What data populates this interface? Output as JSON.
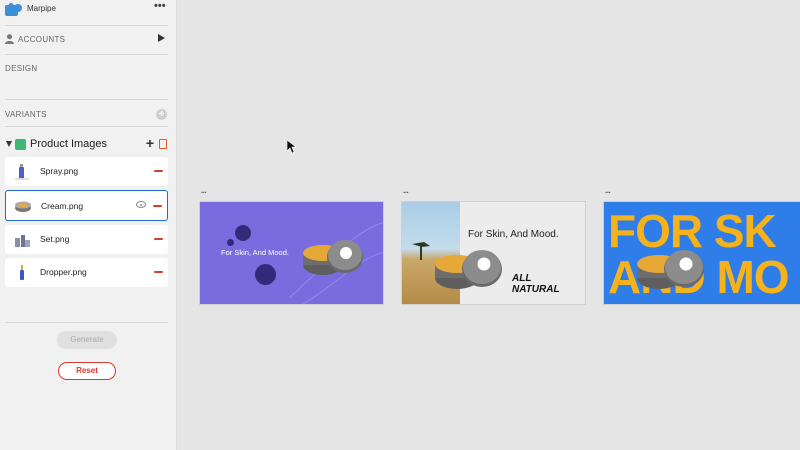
{
  "app": {
    "title": "Marpipe",
    "icons": {
      "logo": "marpipe-logo",
      "more": "more-dots-icon"
    }
  },
  "sidebar": {
    "accounts_label": "ACCOUNTS",
    "design_label": "DESIGN",
    "variants_label": "VARIANTS",
    "group": {
      "label": "Product Images",
      "files": [
        {
          "name": "Spray.png",
          "selected": false
        },
        {
          "name": "Cream.png",
          "selected": true
        },
        {
          "name": "Set.png",
          "selected": false
        },
        {
          "name": "Dropper.png",
          "selected": false
        }
      ]
    },
    "generate_label": "Generate",
    "reset_label": "Reset"
  },
  "canvas": {
    "cards": [
      {
        "menu": "...",
        "headline": "For Skin, And Mood.",
        "background": "#7a6cde"
      },
      {
        "menu": "...",
        "headline": "For Skin, And Mood.",
        "tagline_line1": "ALL",
        "tagline_line2": "NATURAL",
        "background": "#ececec"
      },
      {
        "menu": "...",
        "big_line1": "FOR SK",
        "big_line2": "AND MO",
        "background": "#2f7de9",
        "text_color": "#f6b21b"
      }
    ]
  },
  "colors": {
    "accent_blue": "#1e6bd6",
    "danger": "#d93a2e",
    "group_green": "#3bb874"
  }
}
